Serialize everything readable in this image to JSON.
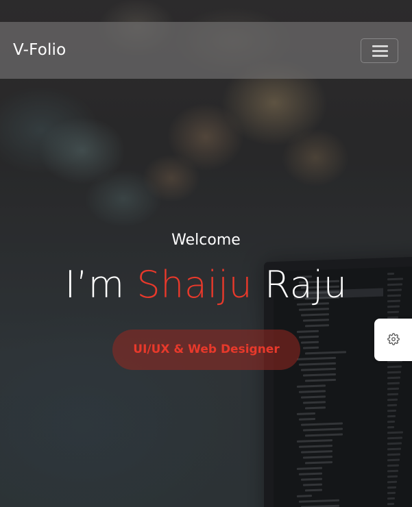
{
  "navbar": {
    "brand": "V-Folio",
    "toggle_icon": "hamburger-menu-icon"
  },
  "hero": {
    "welcome": "Welcome",
    "headline_prefix": "I’m ",
    "headline_highlight": "Shaiju",
    "headline_suffix": " Raju",
    "role": "UI/UX & Web Designer",
    "accent_color": "#e8392b"
  },
  "settings": {
    "icon": "gear-icon"
  }
}
